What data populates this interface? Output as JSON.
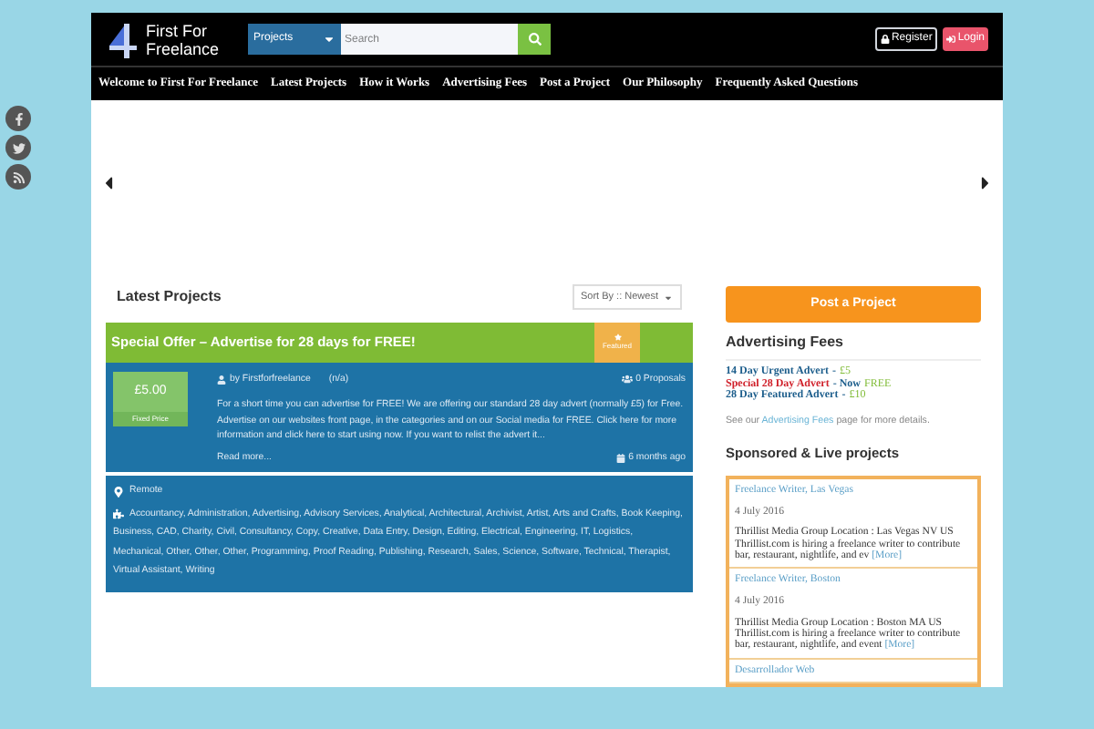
{
  "social": [
    {
      "kind": "facebook"
    },
    {
      "kind": "twitter"
    },
    {
      "kind": "rss"
    }
  ],
  "header": {
    "logo_text": "First For Freelance",
    "search_category": "Projects",
    "search_placeholder": "Search",
    "auth": [
      {
        "kind": "register",
        "label": "Register"
      },
      {
        "kind": "login",
        "label": "Login"
      }
    ]
  },
  "nav": [
    "Welcome to First For Freelance",
    "Latest Projects",
    "How it Works",
    "Advertising Fees",
    "Post a Project",
    "Our Philosophy",
    "Frequently Asked Questions"
  ],
  "main": {
    "heading": "Latest Projects",
    "sort": "Sort By :: Newest",
    "project": {
      "title": "Special Offer – Advertise for 28 days for FREE!",
      "badge": "Featured",
      "price": "£5.00",
      "price_type": "Fixed Price",
      "author": "by Firstforfreelance",
      "rating": "(n/a)",
      "proposals": "0 Proposals",
      "description": "For a short time you can advertise for FREE! We are offering our standard 28 day advert (normally £5) for Free. Advertise on our websites front page, in the categories and on our Social media for FREE. Click here for more information and click here to start using now. If you want to relist the advert it...",
      "read_more": "Read more...",
      "posted": "6 months ago",
      "location": "Remote",
      "skills": "Accountancy, Administration, Advertising, Advisory Services, Analytical, Architectural, Archivist, Artist, Arts and Crafts, Book Keeping, Business, CAD, Charity, Civil, Consultancy, Copy, Creative, Data Entry, Design, Editing, Electrical, Engineering, IT, Logistics, Mechanical, Other, Other, Other, Programming, Proof Reading, Publishing, Research, Sales, Science, Software, Technical, Therapist, Virtual Assistant, Writing"
    }
  },
  "sidebar": {
    "post_button": "Post a Project",
    "fees_heading": "Advertising Fees",
    "fees": [
      {
        "name": "14 Day Urgent Advert",
        "color": "#1d5e8c",
        "note": "-",
        "price": "£5"
      },
      {
        "name": "Special 28 Day Advert",
        "color": "#d0202a",
        "note": "- Now",
        "price": "FREE"
      },
      {
        "name": "28 Day Featured Advert",
        "color": "#1d5e8c",
        "note": "-",
        "price": "£10"
      }
    ],
    "see_more": {
      "before": "See our",
      "link": "Advertising Fees",
      "after": "page for more details."
    },
    "sponsored_heading": "Sponsored & Live projects",
    "jobs": [
      {
        "title": "Freelance Writer, Las Vegas",
        "date": "4 July 2016",
        "description": "Thrillist Media Group Location : Las Vegas NV US Thrillist.com is hiring a freelance writer to contribute bar, restaurant, nightlife, and ev",
        "more": "[More]"
      },
      {
        "title": "Freelance Writer, Boston",
        "date": "4 July 2016",
        "description": "Thrillist Media Group Location : Boston MA US Thrillist.com is hiring a freelance writer to contribute bar, restaurant, nightlife, and event",
        "more": "[More]"
      },
      {
        "title": "Desarrollador Web"
      }
    ]
  }
}
